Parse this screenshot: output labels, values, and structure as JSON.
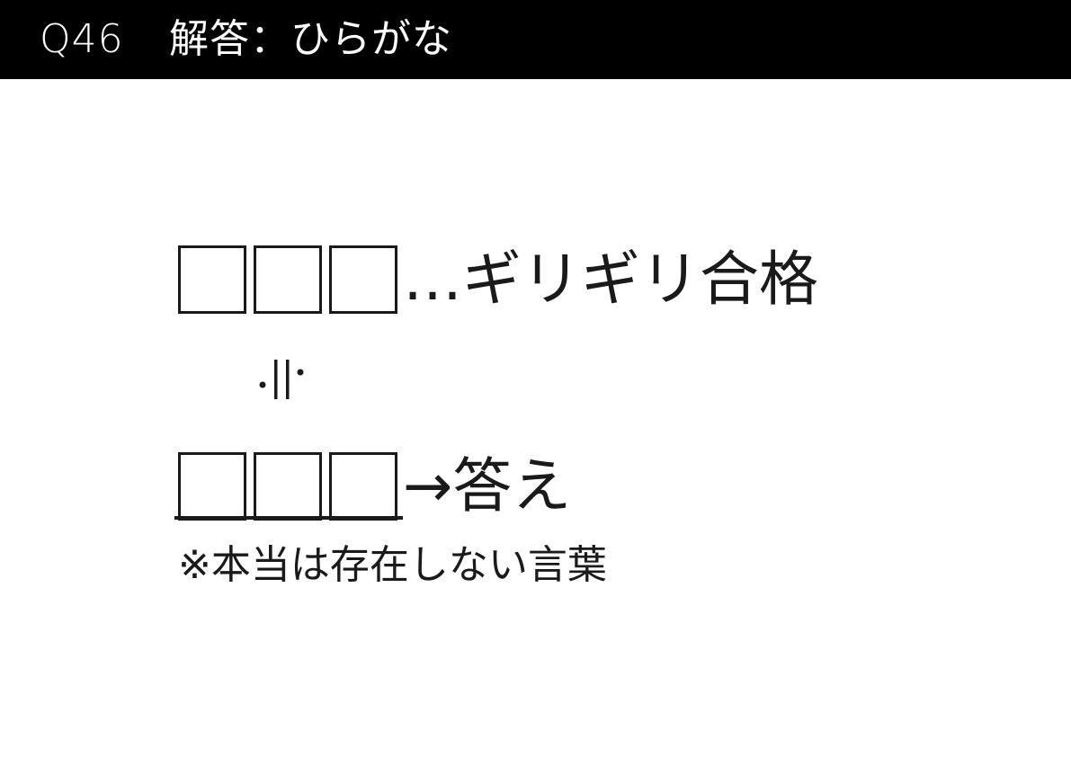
{
  "header": {
    "question_id": "Q46",
    "title": "解答：ひらがな"
  },
  "clue": {
    "meaning_text": "…ギリギリ合格",
    "answer_text": "→答え",
    "box_count": 3
  },
  "note": "※本当は存在しない言葉",
  "colors": {
    "header_background": "#000000",
    "header_text": "#ffffff",
    "ink": "#1a1a1a",
    "background": "#ffffff"
  },
  "icons": {
    "equivalence_symbol": "approximately-equal-icon"
  }
}
